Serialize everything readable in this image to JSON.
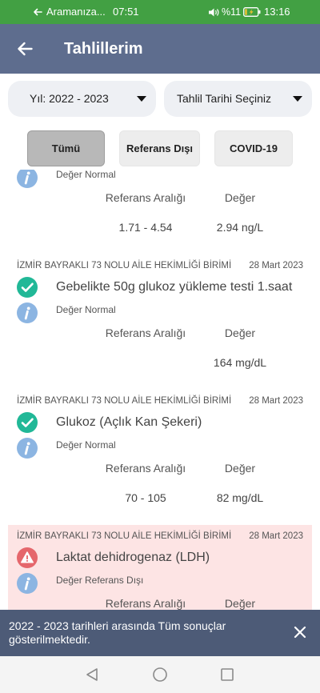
{
  "status_bar": {
    "call_banner": "Aramanıza...",
    "call_timer": "07:51",
    "battery": "%11",
    "clock": "13:16",
    "icons": [
      "back-arrow-icon",
      "volume-icon",
      "battery-charging-icon"
    ]
  },
  "app_bar": {
    "title": "Tahlillerim",
    "back_icon": "arrow-left-icon"
  },
  "filters": {
    "year": {
      "label": "Yıl: 2022 - 2023",
      "icon": "caret-down-icon"
    },
    "test_date": {
      "label": "Tahlil Tarihi Seçiniz",
      "icon": "caret-down-icon"
    }
  },
  "segments": [
    {
      "label": "Tümü",
      "selected": true
    },
    {
      "label": "Referans Dışı",
      "selected": false
    },
    {
      "label": "COVID-19",
      "selected": false
    }
  ],
  "columns": {
    "range": "Referans Aralığı",
    "value": "Değer"
  },
  "results": [
    {
      "info_icon": "info-icon",
      "note": "Değer Normal",
      "range": "1.71 - 4.54",
      "value": "2.94 ng/L",
      "out_of_range": false
    },
    {
      "facility": "İZMİR BAYRAKLI 73 NOLU AİLE HEKİMLİĞİ BİRİMİ",
      "date": "28 Mart 2023",
      "status_icon": "check-circle-icon",
      "name": "Gebelikte 50g glukoz yükleme testi 1.saat",
      "info_icon": "info-icon",
      "note": "Değer Normal",
      "value": "164 mg/dL",
      "out_of_range": false
    },
    {
      "facility": "İZMİR BAYRAKLI 73 NOLU AİLE HEKİMLİĞİ BİRİMİ",
      "date": "28 Mart 2023",
      "status_icon": "check-circle-icon",
      "name": "Glukoz (Açlık Kan Şekeri)",
      "info_icon": "info-icon",
      "note": "Değer Normal",
      "range": "70 - 105",
      "value": "82 mg/dL",
      "out_of_range": false
    },
    {
      "facility": "İZMİR BAYRAKLI 73 NOLU AİLE HEKİMLİĞİ BİRİMİ",
      "date": "28 Mart 2023",
      "status_icon": "warning-icon",
      "name": "Laktat dehidrogenaz (LDH)",
      "info_icon": "info-icon",
      "note": "Değer Referans Dışı",
      "out_of_range": true
    }
  ],
  "snackbar": {
    "message": "2022 - 2023 tarihleri arasında Tüm sonuçlar gösterilmektedir.",
    "close_icon": "close-icon"
  },
  "nav_bar": {
    "icons": [
      "nav-back-icon",
      "nav-home-icon",
      "nav-recents-icon"
    ]
  },
  "colors": {
    "status_bar": "#42a043",
    "app_bar": "#5e6d8e",
    "snackbar": "#4d5b77",
    "ok": "#21b897",
    "info": "#8cb5e2",
    "alert": "#e5676c",
    "alert_bg": "#fde4e4",
    "nav_bar": "#f4f4f4"
  }
}
